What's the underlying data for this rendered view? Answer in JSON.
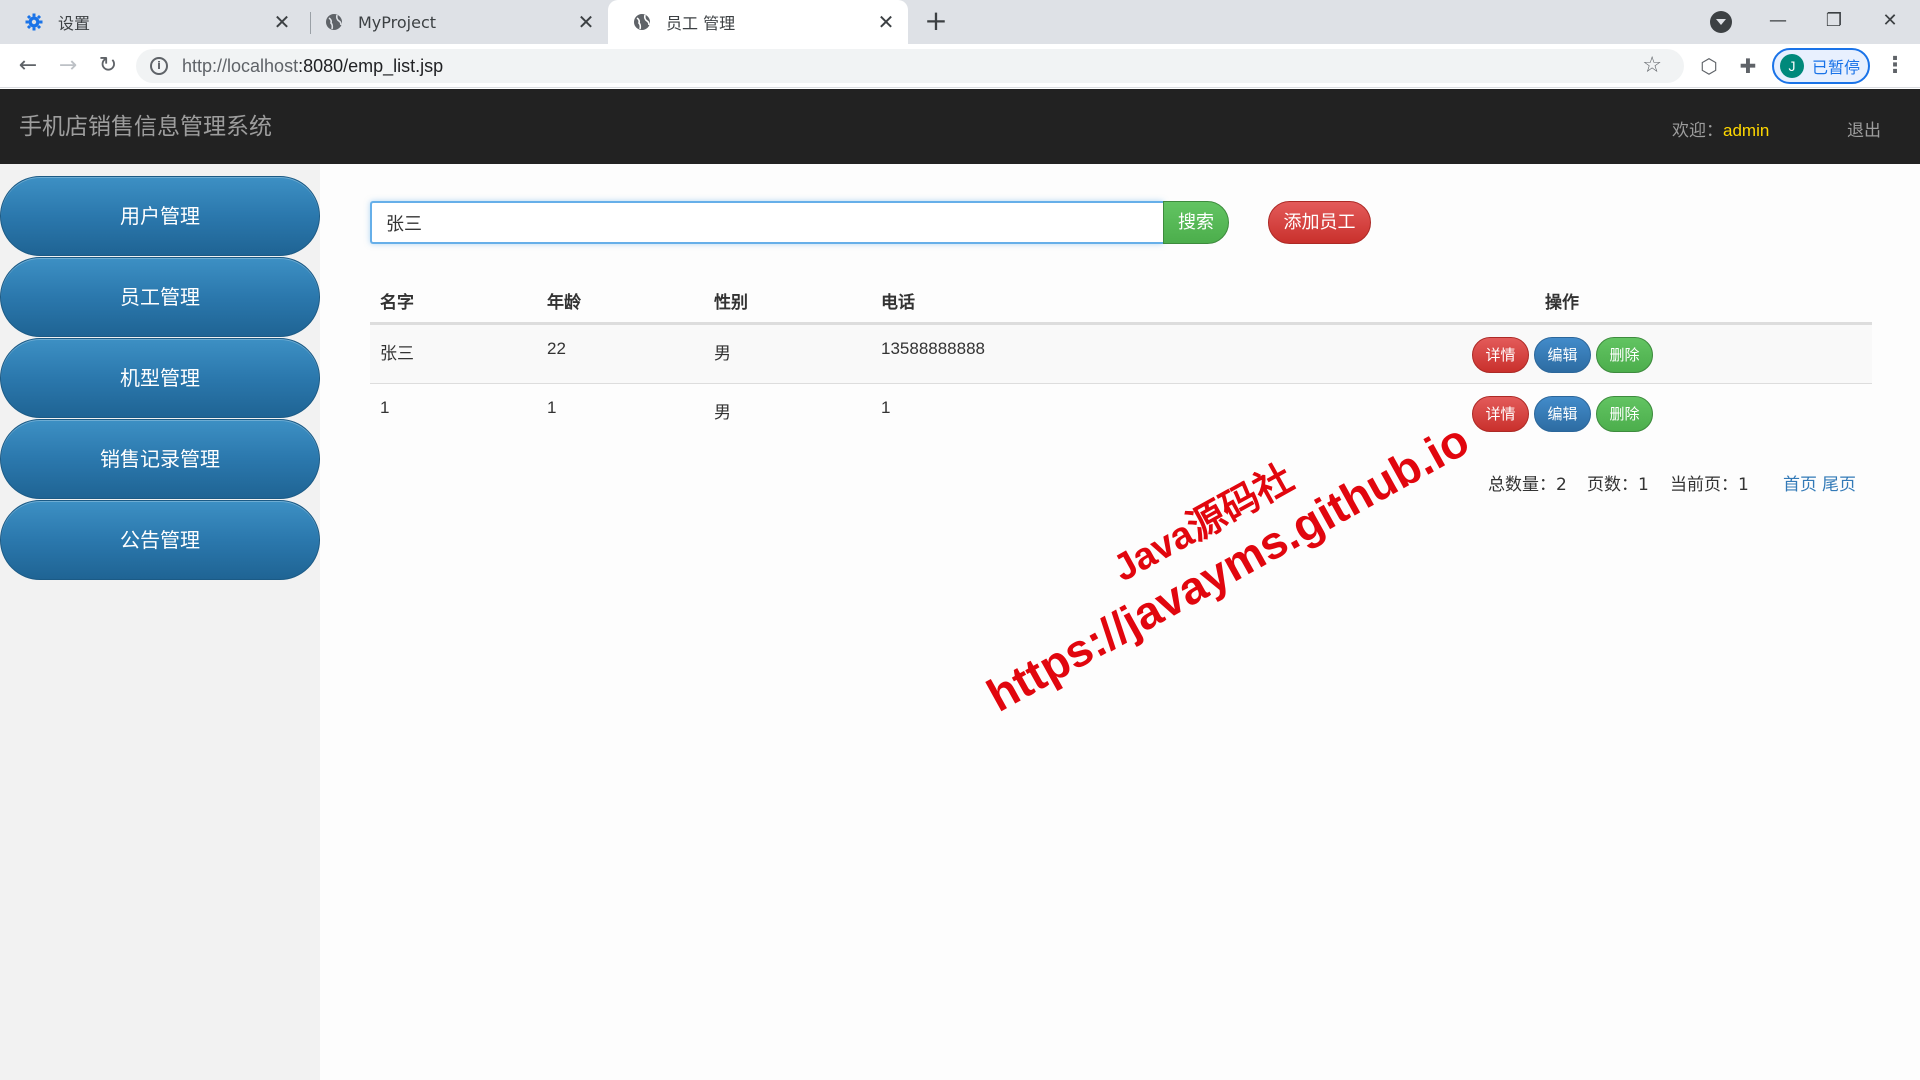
{
  "browser": {
    "tabs": [
      {
        "title": "设置",
        "icon": "gear-icon",
        "active": false
      },
      {
        "title": "MyProject",
        "icon": "globe-icon",
        "active": false
      },
      {
        "title": "员工 管理",
        "icon": "globe-icon",
        "active": true
      }
    ],
    "url_host": "http://localhost",
    "url_path": ":8080/emp_list.jsp",
    "profile_initial": "J",
    "profile_label": "已暂停"
  },
  "header": {
    "brand": "手机店销售信息管理系统",
    "welcome_label": "欢迎：",
    "username": "admin",
    "logout": "退出"
  },
  "sidebar": {
    "items": [
      {
        "label": "用户管理"
      },
      {
        "label": "员工管理"
      },
      {
        "label": "机型管理"
      },
      {
        "label": "销售记录管理"
      },
      {
        "label": "公告管理"
      }
    ]
  },
  "search": {
    "value": "张三",
    "button": "搜索",
    "add_button": "添加员工"
  },
  "table": {
    "columns": [
      "名字",
      "年龄",
      "性别",
      "电话",
      "操作"
    ],
    "rows": [
      {
        "name": "张三",
        "age": "22",
        "gender": "男",
        "phone": "13588888888"
      },
      {
        "name": "1",
        "age": "1",
        "gender": "男",
        "phone": "1"
      }
    ],
    "actions": {
      "detail": "详情",
      "edit": "编辑",
      "delete": "删除"
    }
  },
  "pagination": {
    "total": "总数量：2",
    "pages": "页数：1",
    "current": "当前页：1",
    "first": "首页",
    "last": "尾页"
  },
  "watermark": {
    "line1": "Java源码社",
    "line2": "https://javayms.github.io"
  },
  "colors": {
    "navbar": "#222222",
    "sidebar_button": "#2b78ad",
    "success": "#4cae4c",
    "danger": "#c9302c",
    "primary": "#2d6ca2",
    "username": "#ffd800",
    "watermark": "#e1060e"
  }
}
